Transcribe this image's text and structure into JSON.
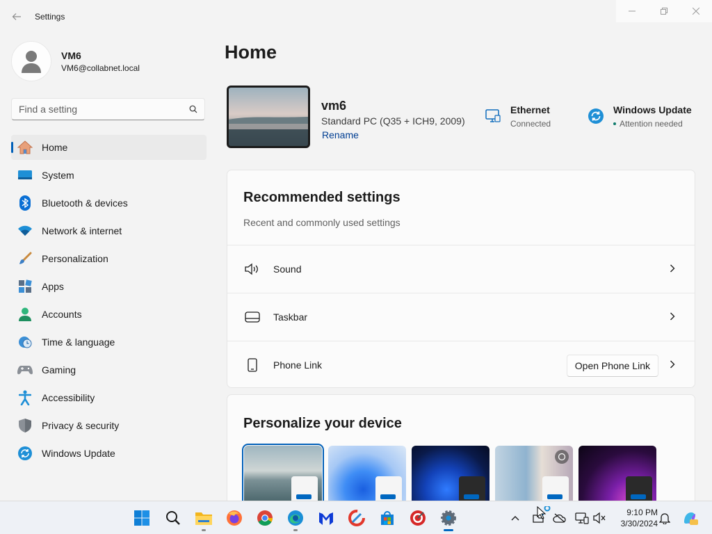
{
  "window": {
    "title": "Settings"
  },
  "profile": {
    "name": "VM6",
    "email": "VM6@collabnet.local"
  },
  "search": {
    "placeholder": "Find a setting"
  },
  "nav": {
    "items": [
      {
        "label": "Home",
        "icon": "home-icon",
        "active": true
      },
      {
        "label": "System",
        "icon": "system-icon"
      },
      {
        "label": "Bluetooth & devices",
        "icon": "bluetooth-icon"
      },
      {
        "label": "Network & internet",
        "icon": "wifi-icon"
      },
      {
        "label": "Personalization",
        "icon": "brush-icon"
      },
      {
        "label": "Apps",
        "icon": "apps-icon"
      },
      {
        "label": "Accounts",
        "icon": "person-icon"
      },
      {
        "label": "Time & language",
        "icon": "clock-globe-icon"
      },
      {
        "label": "Gaming",
        "icon": "gamepad-icon"
      },
      {
        "label": "Accessibility",
        "icon": "accessibility-icon"
      },
      {
        "label": "Privacy & security",
        "icon": "shield-icon"
      },
      {
        "label": "Windows Update",
        "icon": "update-icon"
      }
    ]
  },
  "main": {
    "title": "Home",
    "device": {
      "name": "vm6",
      "description": "Standard PC (Q35 + ICH9, 2009)",
      "rename_label": "Rename"
    },
    "ethernet": {
      "title": "Ethernet",
      "status": "Connected"
    },
    "windows_update": {
      "title": "Windows Update",
      "status": "Attention needed"
    },
    "recommended": {
      "title": "Recommended settings",
      "subtitle": "Recent and commonly used settings",
      "rows": [
        {
          "label": "Sound",
          "icon": "speaker-icon"
        },
        {
          "label": "Taskbar",
          "icon": "taskbar-icon"
        },
        {
          "label": "Phone Link",
          "icon": "phone-icon",
          "button": "Open Phone Link"
        }
      ]
    },
    "personalize": {
      "title": "Personalize your device"
    }
  },
  "taskbar": {
    "apps": [
      "start",
      "search",
      "file-explorer",
      "firefox",
      "chrome",
      "edge",
      "malwarebytes",
      "ccleaner",
      "microsoft-store",
      "app-red",
      "settings"
    ],
    "clock": {
      "time": "9:10 PM",
      "date": "3/30/2024"
    }
  },
  "colors": {
    "accent": "#005fb8",
    "link": "#003e92",
    "background": "#f3f3f3"
  }
}
